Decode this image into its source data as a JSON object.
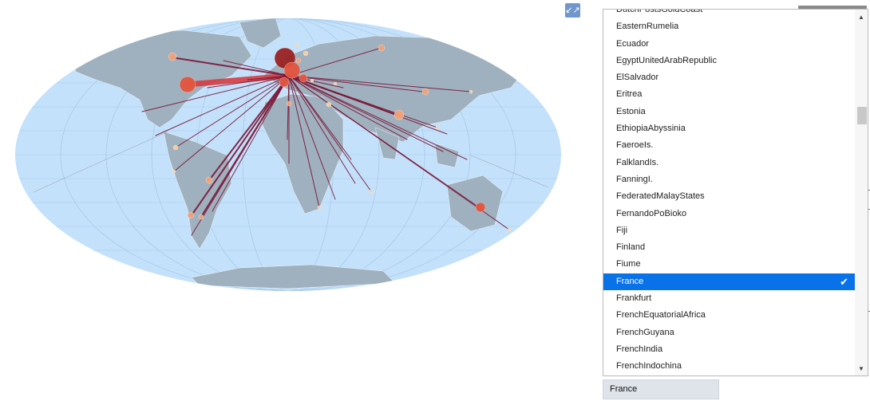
{
  "map": {
    "colors": {
      "ocean": "#c3e1fb",
      "land": "#9fb0be",
      "flow_line": "#7a1636",
      "flow_line_bright": "#d83c42",
      "bubble_large": "#9a2222",
      "bubble_medium": "#e3563f",
      "bubble_small": "#f3a37a",
      "bubble_tiny": "#f9cfa3"
    }
  },
  "collapse_button": {
    "icon": "collapse-arrows-icon"
  },
  "country_list": {
    "options": [
      "DutchPostsGoldCoast",
      "EasternRumelia",
      "Ecuador",
      "EgyptUnitedArabRepublic",
      "ElSalvador",
      "Eritrea",
      "Estonia",
      "EthiopiaAbyssinia",
      "FaeroeIs.",
      "FalklandIs.",
      "FanningI.",
      "FederatedMalayStates",
      "FernandoPoBioko",
      "Fiji",
      "Finland",
      "Fiume",
      "France",
      "Frankfurt",
      "FrenchEquatorialAfrica",
      "FrenchGuyana",
      "FrenchIndia",
      "FrenchIndochina"
    ],
    "selected_index": 16,
    "check_icon": "checkmark-icon",
    "scroll_up_icon": "scroll-up-arrow-icon",
    "scroll_down_icon": "scroll-down-arrow-icon"
  },
  "select": {
    "value": "France"
  }
}
